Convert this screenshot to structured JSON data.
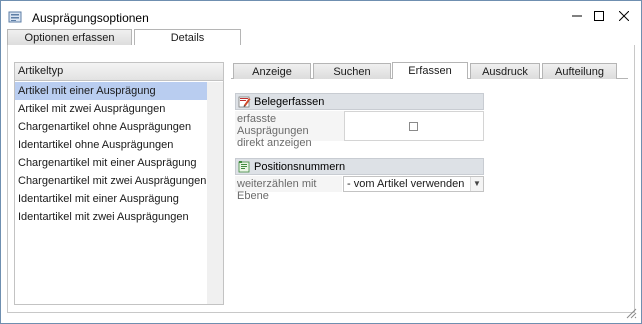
{
  "window": {
    "title": "Ausprägungsoptionen",
    "minimize_glyph": "—",
    "maximize_glyph": "☐",
    "close_glyph": "✕"
  },
  "outer_tabs": [
    {
      "label": "Optionen erfassen",
      "active": false
    },
    {
      "label": "Details",
      "active": true
    }
  ],
  "list": {
    "header": "Artikeltyp",
    "items": [
      "Artikel mit einer Ausprägung",
      "Artikel mit zwei Ausprägungen",
      "Chargenartikel ohne Ausprägungen",
      "Identartikel ohne Ausprägungen",
      "Chargenartikel mit einer Ausprägung",
      "Chargenartikel mit zwei Ausprägungen",
      "Identartikel mit einer Ausprägung",
      "Identartikel mit zwei Ausprägungen"
    ],
    "selected_index": 0
  },
  "inner_tabs": [
    {
      "label": "Anzeige",
      "active": false
    },
    {
      "label": "Suchen",
      "active": false
    },
    {
      "label": "Erfassen",
      "active": true
    },
    {
      "label": "Ausdruck",
      "active": false
    },
    {
      "label": "Aufteilung",
      "active": false
    }
  ],
  "belegerfassen": {
    "title": "Belegerfassen",
    "icon": "edit-icon",
    "field_label_line1": "erfasste Ausprägungen",
    "field_label_line2": "direkt anzeigen",
    "checked": false
  },
  "positionsnummern": {
    "title": "Positionsnummern",
    "icon": "list-edit-icon",
    "field_label": "weiterzählen mit Ebene",
    "combo_value": "- vom Artikel verwenden"
  },
  "colors": {
    "selection": "#b9cdf0",
    "group_header_bg": "#dde1e6",
    "window_border": "#6f8fb0"
  }
}
